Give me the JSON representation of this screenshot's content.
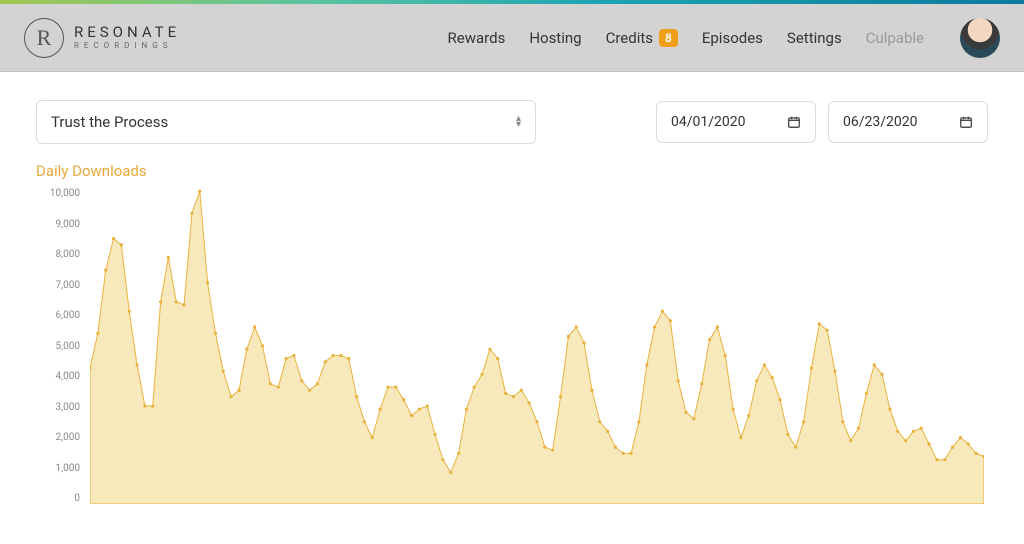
{
  "brand": {
    "name": "RESONATE",
    "sub": "RECORDINGS"
  },
  "nav": {
    "items": [
      {
        "label": "Rewards"
      },
      {
        "label": "Hosting"
      },
      {
        "label": "Credits",
        "badge": "8"
      },
      {
        "label": "Episodes"
      },
      {
        "label": "Settings"
      },
      {
        "label": "Culpable",
        "muted": true
      }
    ]
  },
  "controls": {
    "podcast_selected": "Trust the Process",
    "date_from": "04/01/2020",
    "date_to": "06/23/2020"
  },
  "chart": {
    "title": "Daily Downloads"
  },
  "chart_data": {
    "type": "area",
    "title": "Daily Downloads",
    "xlabel": "",
    "ylabel": "",
    "ylim": [
      0,
      10000
    ],
    "y_ticks": [
      "10,000",
      "9,000",
      "8,000",
      "7,000",
      "6,000",
      "5,000",
      "4,000",
      "3,000",
      "2,000",
      "1,000",
      "0"
    ],
    "x_range": [
      "2020-04-01",
      "2020-06-23"
    ],
    "values": [
      4300,
      5400,
      7400,
      8400,
      8200,
      6100,
      4400,
      3100,
      3100,
      6400,
      7800,
      6400,
      6300,
      9200,
      9900,
      7000,
      5400,
      4200,
      3400,
      3600,
      4900,
      5600,
      5000,
      3800,
      3700,
      4600,
      4700,
      3900,
      3600,
      3800,
      4500,
      4700,
      4700,
      4600,
      3400,
      2600,
      2100,
      3000,
      3700,
      3700,
      3300,
      2800,
      3000,
      3100,
      2200,
      1400,
      1000,
      1600,
      3000,
      3700,
      4100,
      4900,
      4600,
      3500,
      3400,
      3600,
      3200,
      2600,
      1800,
      1700,
      3400,
      5300,
      5600,
      5100,
      3600,
      2600,
      2300,
      1800,
      1600,
      1600,
      2600,
      4400,
      5600,
      6100,
      5800,
      3900,
      2900,
      2700,
      3800,
      5200,
      5600,
      4700,
      3000,
      2100,
      2800,
      3900,
      4400,
      4000,
      3300,
      2200,
      1800,
      2600,
      4300,
      5700,
      5500,
      4200,
      2600,
      2000,
      2400,
      3500,
      4400,
      4100,
      3000,
      2300,
      2000,
      2300,
      2400,
      1900,
      1400,
      1400,
      1800,
      2100,
      1900,
      1600,
      1500
    ]
  }
}
